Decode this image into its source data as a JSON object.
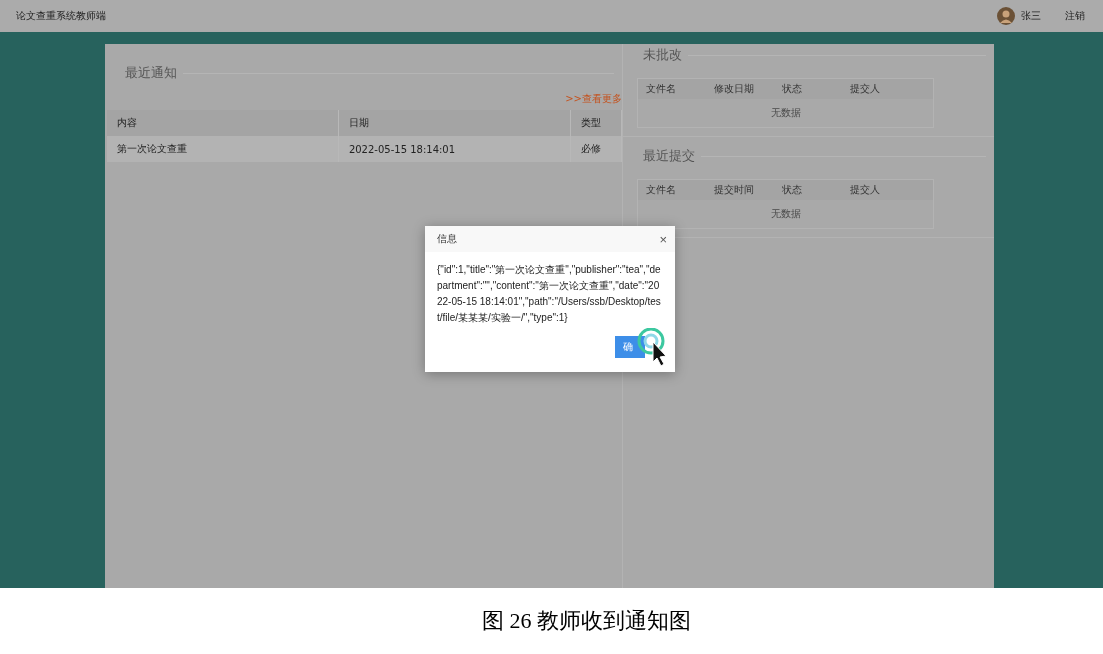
{
  "app_title": "论文查重系统教师端",
  "user": {
    "name": "张三",
    "logout": "注销"
  },
  "notices": {
    "title": "最近通知",
    "more_link": ">>查看更多",
    "columns": [
      "内容",
      "日期",
      "类型"
    ],
    "rows": [
      [
        "第一次论文查重",
        "2022-05-15 18:14:01",
        "必修"
      ]
    ]
  },
  "ungraded": {
    "title": "未批改",
    "columns": [
      "文件名",
      "修改日期",
      "状态",
      "提交人"
    ],
    "empty_text": "无数据"
  },
  "recent_submissions": {
    "title": "最近提交",
    "columns": [
      "文件名",
      "提交时间",
      "状态",
      "提交人"
    ],
    "empty_text": "无数据"
  },
  "dialog": {
    "title": "信息",
    "close": "×",
    "message": "{\"id\":1,\"title\":\"第一次论文查重\",\"publisher\":\"tea\",\"department\":\"\",\"content\":\"第一次论文查重\",\"date\":\"2022-05-15 18:14:01\",\"path\":\"/Users/ssb/Desktop/test/file/某某某/实验一/\",\"type\":1}",
    "button": "确"
  },
  "caption": "图 26 教师收到通知图"
}
